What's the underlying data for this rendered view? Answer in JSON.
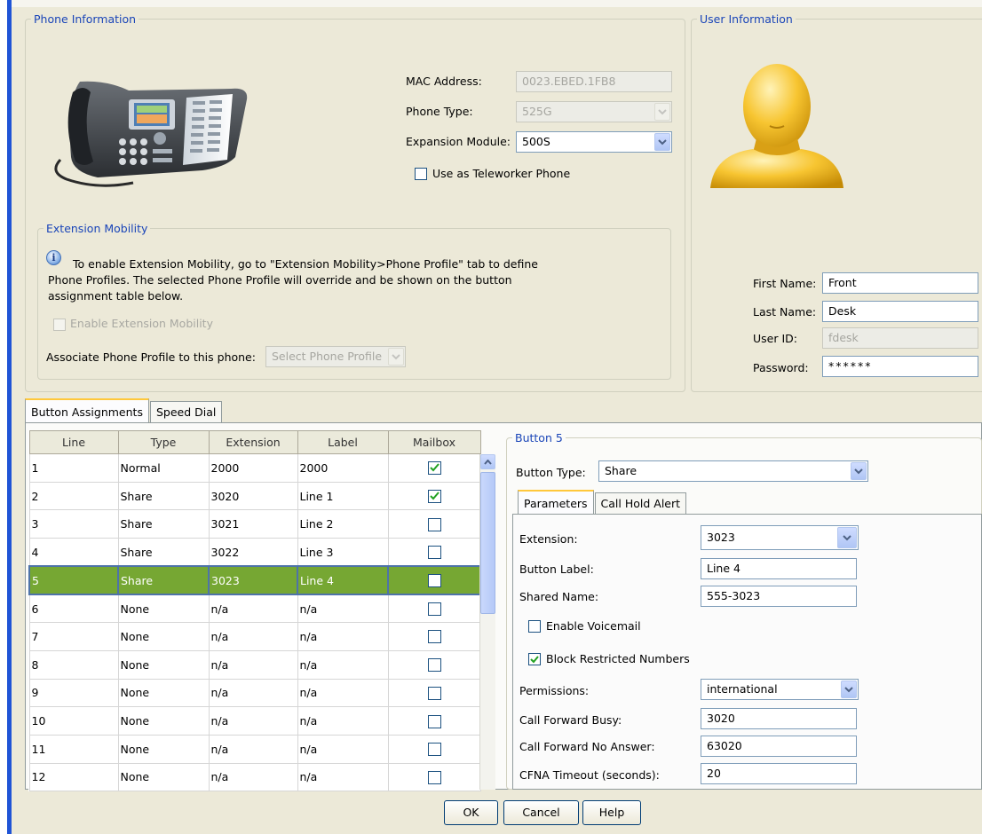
{
  "phone_info": {
    "legend": "Phone Information",
    "mac_label": "MAC Address:",
    "mac_value": "0023.EBED.1FB8",
    "type_label": "Phone Type:",
    "type_value": "525G",
    "expansion_label": "Expansion Module:",
    "expansion_value": "500S",
    "teleworker_label": "Use as Teleworker Phone",
    "teleworker_checked": false
  },
  "extension_mobility": {
    "legend": "Extension Mobility",
    "info_line1": "To enable Extension Mobility, go to \"Extension Mobility>Phone Profile\" tab to define",
    "info_line2": "Phone Profiles. The selected Phone Profile will override and be shown on the button",
    "info_line3": "assignment table below.",
    "enable_label": "Enable Extension Mobility",
    "associate_label": "Associate Phone Profile to this phone:",
    "profile_placeholder": "Select Phone Profile"
  },
  "user_info": {
    "legend": "User Information",
    "first_name_label": "First Name:",
    "first_name": "Front",
    "last_name_label": "Last Name:",
    "last_name": "Desk",
    "user_id_label": "User ID:",
    "user_id": "fdesk",
    "password_label": "Password:",
    "password": "******"
  },
  "tabs": [
    "Button Assignments",
    "Speed Dial"
  ],
  "table": {
    "headers": [
      "Line",
      "Type",
      "Extension",
      "Label",
      "Mailbox"
    ],
    "rows": [
      {
        "line": "1",
        "type": "Normal",
        "ext": "2000",
        "label": "2000",
        "mailbox": true
      },
      {
        "line": "2",
        "type": "Share",
        "ext": "3020",
        "label": "Line 1",
        "mailbox": true
      },
      {
        "line": "3",
        "type": "Share",
        "ext": "3021",
        "label": "Line 2",
        "mailbox": false
      },
      {
        "line": "4",
        "type": "Share",
        "ext": "3022",
        "label": "Line 3",
        "mailbox": false
      },
      {
        "line": "5",
        "type": "Share",
        "ext": "3023",
        "label": "Line 4",
        "mailbox": false
      },
      {
        "line": "6",
        "type": "None",
        "ext": "n/a",
        "label": "n/a",
        "mailbox": false
      },
      {
        "line": "7",
        "type": "None",
        "ext": "n/a",
        "label": "n/a",
        "mailbox": false
      },
      {
        "line": "8",
        "type": "None",
        "ext": "n/a",
        "label": "n/a",
        "mailbox": false
      },
      {
        "line": "9",
        "type": "None",
        "ext": "n/a",
        "label": "n/a",
        "mailbox": false
      },
      {
        "line": "10",
        "type": "None",
        "ext": "n/a",
        "label": "n/a",
        "mailbox": false
      },
      {
        "line": "11",
        "type": "None",
        "ext": "n/a",
        "label": "n/a",
        "mailbox": false
      },
      {
        "line": "12",
        "type": "None",
        "ext": "n/a",
        "label": "n/a",
        "mailbox": false
      }
    ],
    "selected_row": 4
  },
  "button5": {
    "legend": "Button 5",
    "button_type_label": "Button Type:",
    "button_type_value": "Share",
    "tabs": [
      "Parameters",
      "Call Hold Alert"
    ],
    "extension_label": "Extension:",
    "extension_value": "3023",
    "button_label_label": "Button Label:",
    "button_label_value": "Line 4",
    "shared_name_label": "Shared Name:",
    "shared_name_value": "555-3023",
    "enable_voicemail_label": "Enable Voicemail",
    "enable_voicemail_checked": false,
    "block_restricted_label": "Block Restricted Numbers",
    "block_restricted_checked": true,
    "permissions_label": "Permissions:",
    "permissions_value": "international",
    "cfb_label": "Call Forward Busy:",
    "cfb_value": "3020",
    "cfna_label": "Call Forward No Answer:",
    "cfna_value": "63020",
    "cfna_timeout_label": "CFNA Timeout (seconds):",
    "cfna_timeout_value": "20"
  },
  "footer": {
    "ok": "OK",
    "cancel": "Cancel",
    "help": "Help"
  }
}
